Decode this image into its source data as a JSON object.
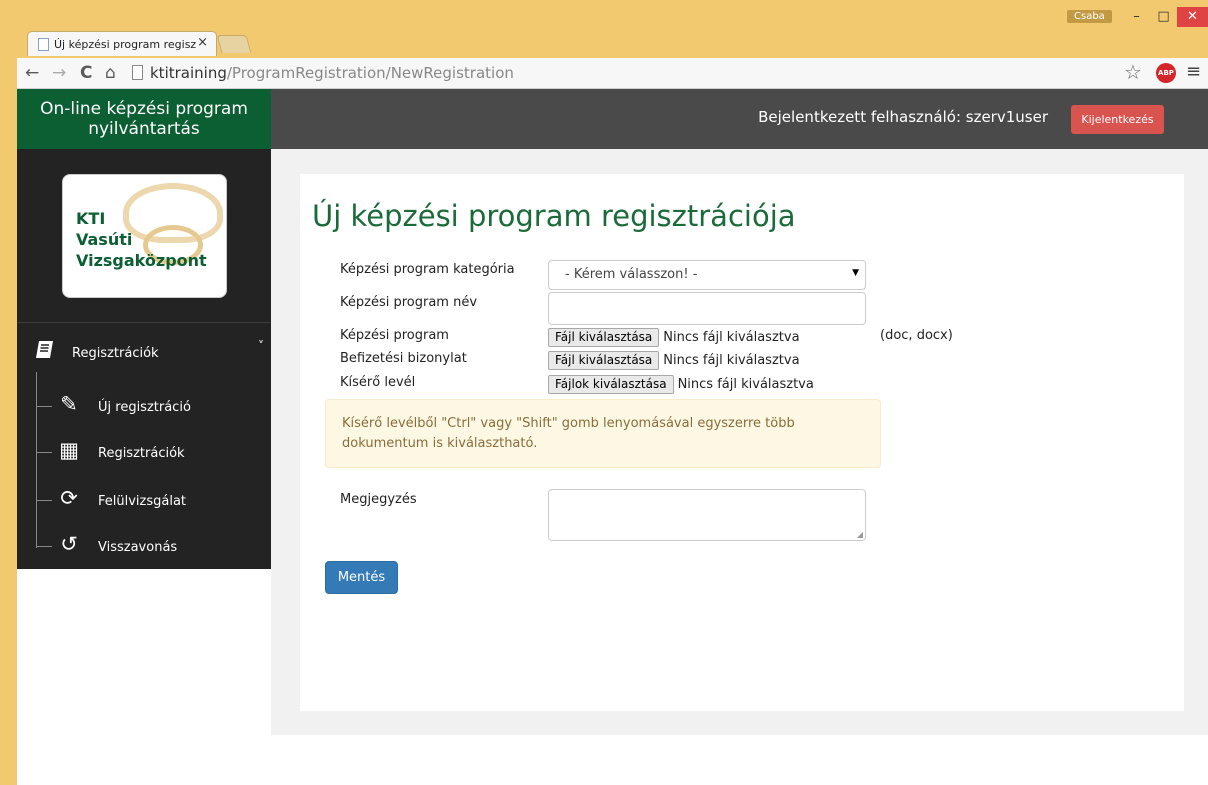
{
  "browser": {
    "tab_title": "Új képzési program regisz",
    "tab_close": "×",
    "user_badge": "Csaba",
    "url_host": "ktitraining",
    "url_path": "/ProgramRegistration/NewRegistration",
    "abp_label": "ABP",
    "win_min": "–",
    "win_max": "□",
    "win_close": "✕",
    "back": "←",
    "forward": "→",
    "reload": "C",
    "home": "⌂",
    "star": "☆",
    "menu": "≡"
  },
  "header": {
    "brand": "On-line képzési program nyilvántartás",
    "logged_in_text": "Bejelentkezett felhasználó: szerv1user",
    "logout_label": "Kijelentkezés"
  },
  "sidebar": {
    "logo_text": "KTI\nVasúti\nVizsgaközpont",
    "group": {
      "label": "Regisztrációk",
      "icon": "book-icon",
      "chevron": "˅"
    },
    "items": [
      {
        "label": "Új regisztráció",
        "icon": "edit-icon",
        "glyph": "✎"
      },
      {
        "label": "Regisztrációk",
        "icon": "table-icon",
        "glyph": "▦"
      },
      {
        "label": "Felülvizsgálat",
        "icon": "refresh-icon",
        "glyph": "⟳"
      },
      {
        "label": "Visszavonás",
        "icon": "undo-icon",
        "glyph": "↺"
      }
    ]
  },
  "form": {
    "title": "Új képzési program regisztrációja",
    "category_label": "Képzési program kategória",
    "category_selected": "- Kérem válasszon! -",
    "name_label": "Képzési program név",
    "name_value": "",
    "program_label": "Képzési program",
    "program_button": "Fájl kiválasztása",
    "program_status": "Nincs fájl kiválasztva",
    "program_hint": "(doc, docx)",
    "receipt_label": "Befizetési bizonylat",
    "receipt_button": "Fájl kiválasztása",
    "receipt_status": "Nincs fájl kiválasztva",
    "letter_label": "Kísérő levél",
    "letter_button": "Fájlok kiválasztása",
    "letter_status": "Nincs fájl kiválasztva",
    "alert_text": "Kísérő levélből \"Ctrl\" vagy \"Shift\" gomb lenyomásával egyszerre több dokumentum is kiválasztható.",
    "note_label": "Megjegyzés",
    "note_value": "",
    "save_label": "Mentés"
  },
  "colors": {
    "brand_green": "#0b5f32",
    "title_green": "#1b6b3a",
    "logout_red": "#d9534f",
    "primary_blue": "#337ab7",
    "alert_bg": "#fcf8e3",
    "sidebar_bg": "#232323",
    "header_bg": "#4a4a4a",
    "chrome_bg": "#f3c96f"
  }
}
